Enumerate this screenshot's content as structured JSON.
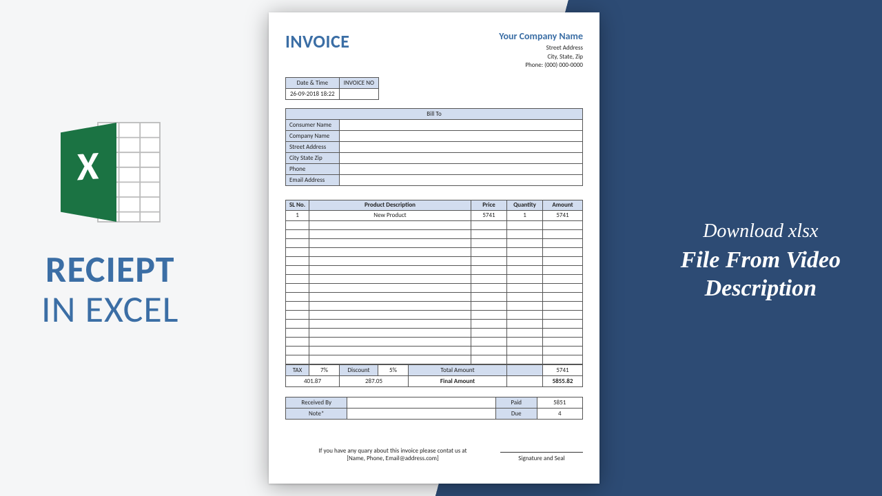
{
  "left": {
    "title1": "RECIEPT",
    "title2": "IN EXCEL"
  },
  "right": {
    "sub": "Download xlsx",
    "line1": "File From Video",
    "line2": "Description"
  },
  "invoice": {
    "title": "INVOICE",
    "dt_label": "Date & Time",
    "dt_value": "26-09-2018 18:22",
    "invno_label": "INVOICE NO",
    "invno_value": "",
    "company": {
      "name": "Your Company Name",
      "street": "Street Address",
      "citystate": "City, State, Zip",
      "phone": "Phone: (000) 000-0000"
    },
    "billto": {
      "section": "Bill To",
      "consumer": "Consumer Name",
      "company": "Company Name",
      "street": "Street Address",
      "citystate": "City State Zip",
      "phone": "Phone",
      "email": "Email Address"
    },
    "items_header": {
      "sl": "SL No.",
      "desc": "Product Description",
      "price": "Price",
      "qty": "Quantity",
      "amt": "Amount"
    },
    "items": [
      {
        "sl": "1",
        "desc": "New Product",
        "price": "5741",
        "qty": "1",
        "amt": "5741"
      }
    ],
    "blank_item_rows": 16,
    "totals": {
      "tax_label": "TAX",
      "tax_pct": "7%",
      "discount_label": "Discount",
      "discount_pct": "5%",
      "total_label": "Total Amount",
      "total_value": "5741",
      "tax_value": "401.87",
      "discount_value": "287.05",
      "final_label": "Final Amount",
      "final_value": "5855.82"
    },
    "recv": {
      "received_label": "Received By",
      "paid_label": "Paid",
      "paid_value": "5851",
      "note_label": "Note*",
      "due_label": "Due",
      "due_value": "4"
    },
    "footer": {
      "line1": "If you have any quary about this invoice please contat us at",
      "line2": "[Name, Phone, Email@address.com]",
      "sig": "Signature and Seal"
    }
  }
}
